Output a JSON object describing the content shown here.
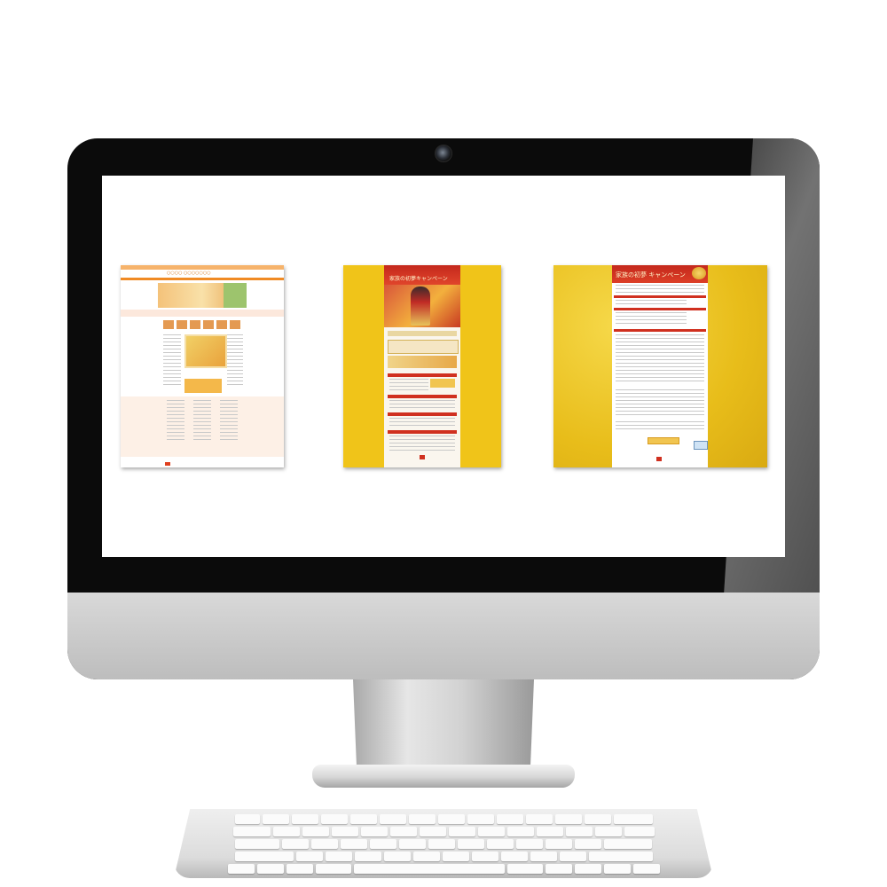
{
  "screen": {
    "thumbnails": [
      {
        "name": "store-homepage",
        "background": "#ffffff",
        "accent": "#f08a24",
        "header_text": "○○○○ ○○○○○○○"
      },
      {
        "name": "campaign-landing-page",
        "background": "#f0c419",
        "accent": "#d0301f",
        "banner_title": "家族の初夢キャンペーン"
      },
      {
        "name": "campaign-entry-form",
        "background": "#e8bd1a",
        "accent": "#d0301f",
        "banner_title": "家族の初夢 キャンペーン",
        "submit_label": "○○○○○○○"
      }
    ]
  },
  "colors": {
    "bezel": "#0b0b0b",
    "chin": "#cfcfcf",
    "screen": "#ffffff"
  }
}
